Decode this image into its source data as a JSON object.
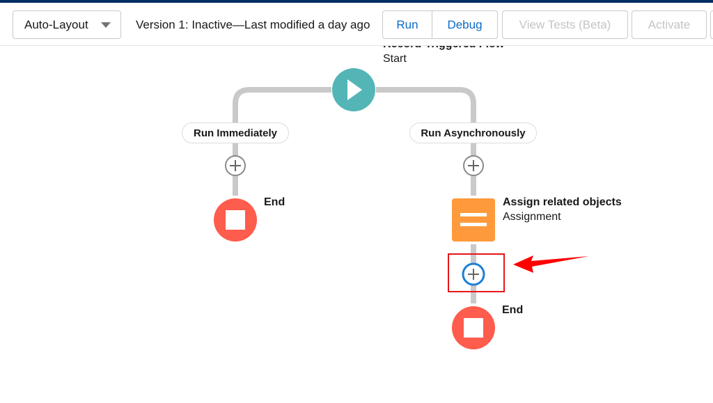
{
  "toolbar": {
    "layout_select": "Auto-Layout",
    "version_status": "Version 1: Inactive—Last modified a day ago",
    "run_label": "Run",
    "debug_label": "Debug",
    "view_tests_label": "View Tests (Beta)",
    "activate_label": "Activate"
  },
  "flow": {
    "start": {
      "title": "Record-Triggered Flow",
      "subtitle": "Start",
      "color": "#54b5b6"
    },
    "paths": [
      {
        "label": "Run Immediately"
      },
      {
        "label": "Run Asynchronously"
      }
    ],
    "assignment": {
      "title": "Assign related objects",
      "subtitle": "Assignment",
      "color": "#fe9a3b"
    },
    "end_left": {
      "label": "End",
      "color": "#fe5c4c"
    },
    "end_right": {
      "label": "End",
      "color": "#fe5c4c"
    }
  },
  "annotation": {
    "highlight_color": "#e8141a",
    "arrow_color": "#ff0000"
  }
}
